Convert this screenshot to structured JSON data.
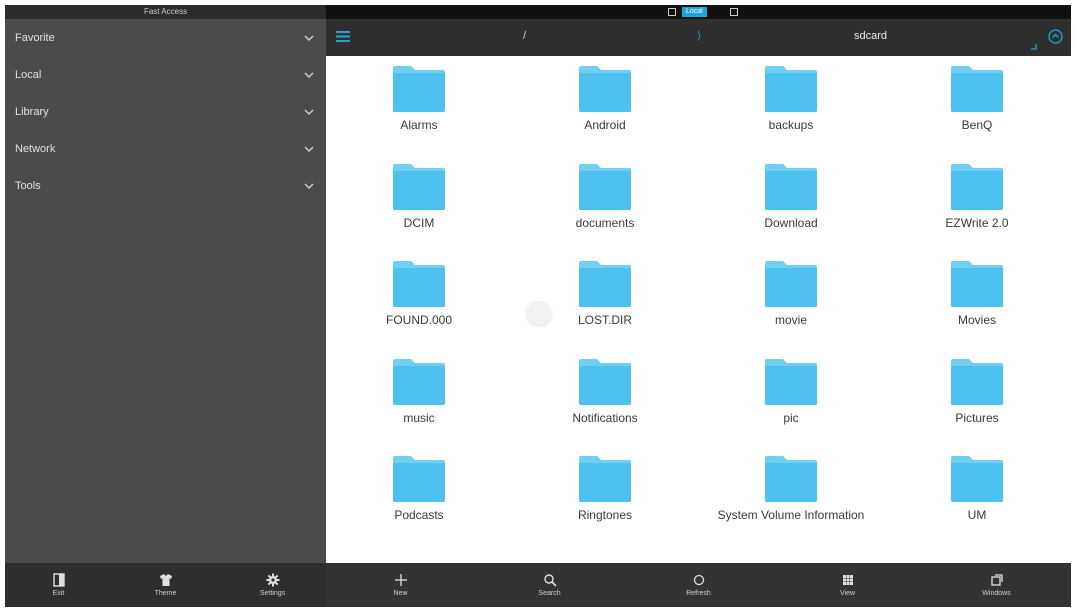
{
  "sidebar": {
    "title": "Fast Access",
    "items": [
      {
        "label": "Favorite"
      },
      {
        "label": "Local"
      },
      {
        "label": "Library"
      },
      {
        "label": "Network"
      },
      {
        "label": "Tools"
      }
    ],
    "bottom": [
      {
        "label": "Exit",
        "icon": "exit-icon"
      },
      {
        "label": "Theme",
        "icon": "shirt-icon"
      },
      {
        "label": "Settings",
        "icon": "gear-icon"
      }
    ]
  },
  "tabs": {
    "active_label": "Local"
  },
  "path": {
    "root": "/",
    "separator": "⟩",
    "current": "sdcard"
  },
  "folders": [
    "Alarms",
    "Android",
    "backups",
    "BenQ",
    "DCIM",
    "documents",
    "Download",
    "EZWrite 2.0",
    "FOUND.000",
    "LOST.DIR",
    "movie",
    "Movies",
    "music",
    "Notifications",
    "pic",
    "Pictures",
    "Podcasts",
    "Ringtones",
    "System Volume Information",
    "UM"
  ],
  "toolbar": [
    {
      "label": "New",
      "icon": "plus-icon"
    },
    {
      "label": "Search",
      "icon": "search-icon"
    },
    {
      "label": "Refresh",
      "icon": "refresh-icon"
    },
    {
      "label": "View",
      "icon": "grid-view-icon"
    },
    {
      "label": "Windows",
      "icon": "windows-icon"
    }
  ],
  "colors": {
    "accent": "#1aa6d9",
    "folder": "#4fc1ee",
    "folder_tab": "#6fd0f3"
  }
}
